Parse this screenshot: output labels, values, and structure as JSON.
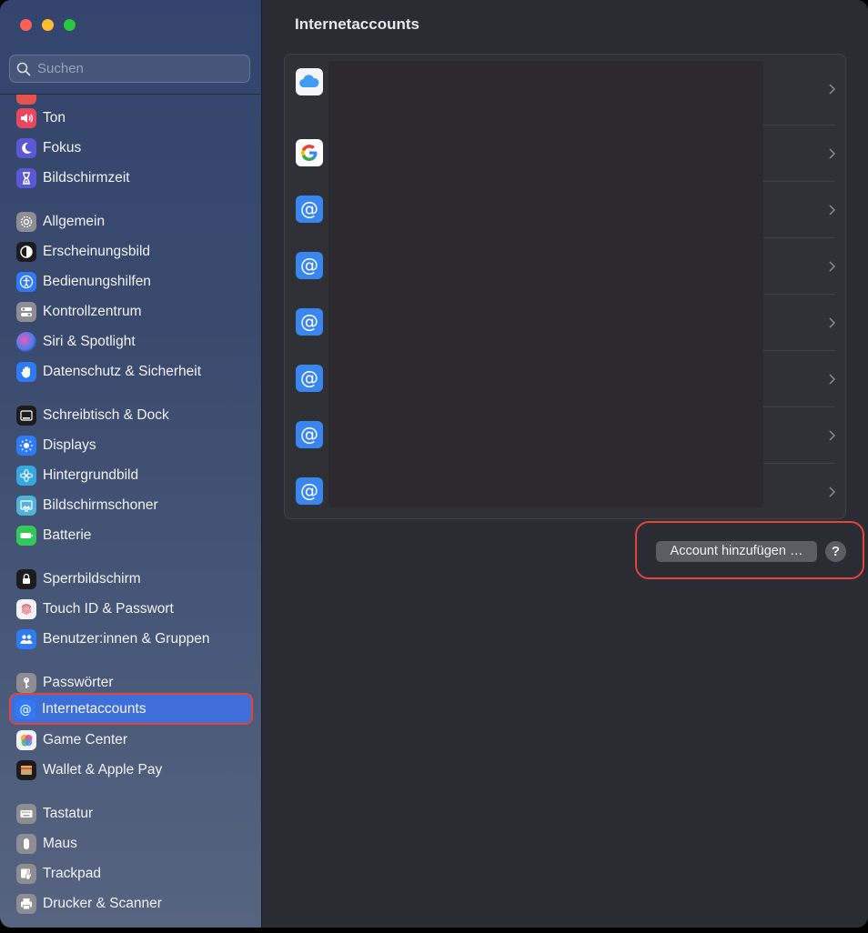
{
  "window": {
    "title": "Internetaccounts",
    "traffic_lights": {
      "close": "#fe5f57",
      "minimize": "#febc2e",
      "maximize": "#28c840"
    }
  },
  "search": {
    "placeholder": "Suchen",
    "value": ""
  },
  "sidebar": {
    "items": [
      {
        "label": "",
        "icon": "bell-icon",
        "color": "#e5534b",
        "partial": true
      },
      {
        "label": "Ton",
        "icon": "speaker-icon",
        "color": "#e8475e"
      },
      {
        "label": "Fokus",
        "icon": "moon-icon",
        "color": "#5b58d6"
      },
      {
        "label": "Bildschirmzeit",
        "icon": "hourglass-icon",
        "color": "#5b58d6"
      },
      {
        "label": "Allgemein",
        "icon": "gear-icon",
        "color": "#8d8d93"
      },
      {
        "label": "Erscheinungsbild",
        "icon": "appearance-icon",
        "color": "#1c1c1e"
      },
      {
        "label": "Bedienungshilfen",
        "icon": "accessibility-icon",
        "color": "#2f7bf5"
      },
      {
        "label": "Kontrollzentrum",
        "icon": "toggles-icon",
        "color": "#8d8d93"
      },
      {
        "label": "Siri & Spotlight",
        "icon": "siri-icon",
        "color": "#6b3fa0"
      },
      {
        "label": "Datenschutz & Sicherheit",
        "icon": "hand-icon",
        "color": "#2f7bf5"
      },
      {
        "label": "Schreibtisch & Dock",
        "icon": "dock-icon",
        "color": "#1c1c1e"
      },
      {
        "label": "Displays",
        "icon": "sun-icon",
        "color": "#2f7bf5"
      },
      {
        "label": "Hintergrundbild",
        "icon": "flower-icon",
        "color": "#35a8e0"
      },
      {
        "label": "Bildschirmschoner",
        "icon": "screensaver-icon",
        "color": "#52b3d9"
      },
      {
        "label": "Batterie",
        "icon": "battery-icon",
        "color": "#34c759"
      },
      {
        "label": "Sperrbildschirm",
        "icon": "lock-icon",
        "color": "#1c1c1e"
      },
      {
        "label": "Touch ID & Passwort",
        "icon": "fingerprint-icon",
        "color": "#f2f2f4"
      },
      {
        "label": "Benutzer:innen & Gruppen",
        "icon": "users-icon",
        "color": "#2f7bf5"
      },
      {
        "label": "Passwörter",
        "icon": "key-icon",
        "color": "#8d8d93"
      },
      {
        "label": "Internetaccounts",
        "icon": "at-icon",
        "color": "#2f7bf5",
        "selected": true
      },
      {
        "label": "Game Center",
        "icon": "game-center-icon",
        "color": "#f2f2f4"
      },
      {
        "label": "Wallet & Apple Pay",
        "icon": "wallet-icon",
        "color": "#1c1c1e"
      },
      {
        "label": "Tastatur",
        "icon": "keyboard-icon",
        "color": "#8d8d93"
      },
      {
        "label": "Maus",
        "icon": "mouse-icon",
        "color": "#8d8d93"
      },
      {
        "label": "Trackpad",
        "icon": "trackpad-icon",
        "color": "#8d8d93"
      },
      {
        "label": "Drucker & Scanner",
        "icon": "printer-icon",
        "color": "#8d8d93"
      }
    ]
  },
  "main": {
    "title": "Internetaccounts",
    "accounts": [
      {
        "icon": "icloud-icon"
      },
      {
        "icon": "google-icon"
      },
      {
        "icon": "at-icon"
      },
      {
        "icon": "at-icon"
      },
      {
        "icon": "at-icon"
      },
      {
        "icon": "at-icon"
      },
      {
        "icon": "at-icon"
      },
      {
        "icon": "at-icon"
      }
    ],
    "add_account_label": "Account hinzufügen …",
    "help_label": "?"
  },
  "colors": {
    "accent": "#3e6fd9",
    "highlight": "#e0453a",
    "at_blue": "#3a86f0"
  }
}
